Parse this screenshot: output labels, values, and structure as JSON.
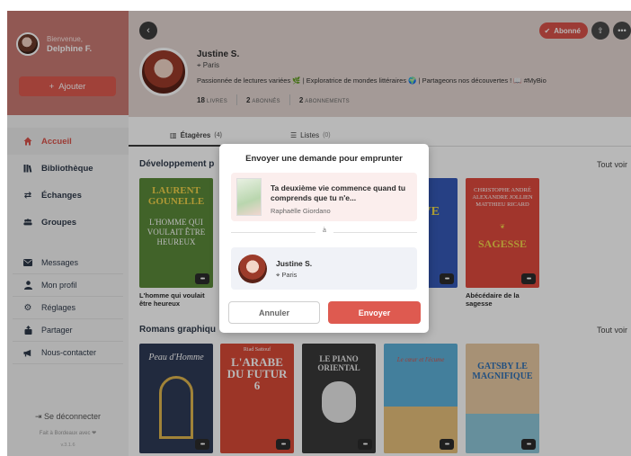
{
  "sidebar": {
    "greeting": "Bienvenue,",
    "user_name": "Delphine F.",
    "add_label": "Ajouter",
    "main_items": [
      {
        "label": "Accueil",
        "icon": "home-icon"
      },
      {
        "label": "Bibliothèque",
        "icon": "library-icon"
      },
      {
        "label": "Échanges",
        "icon": "exchange-icon"
      },
      {
        "label": "Groupes",
        "icon": "groups-icon"
      }
    ],
    "secondary_items": [
      {
        "label": "Messages",
        "icon": "mail-icon"
      },
      {
        "label": "Mon profil",
        "icon": "user-icon"
      },
      {
        "label": "Réglages",
        "icon": "gear-icon"
      },
      {
        "label": "Partager",
        "icon": "share-icon"
      },
      {
        "label": "Nous-contacter",
        "icon": "megaphone-icon"
      }
    ],
    "logout": "Se déconnecter",
    "made_in": "Fait à Bordeaux avec ❤",
    "version": "v.3.1.6"
  },
  "profile": {
    "subscribed_label": "Abonné",
    "name": "Justine S.",
    "city": "Paris",
    "bio": "Passionnée de lectures variées 🌿 | Exploratrice de mondes littéraires 🌍 | Partageons nos découvertes ! 📖 #MyBio",
    "stats": {
      "books_count": "18",
      "books_label": "LIVRES",
      "followers_count": "2",
      "followers_label": "ABONNÉS",
      "following_count": "2",
      "following_label": "ABONNEMENTS"
    }
  },
  "tabs": [
    {
      "label": "Étagères",
      "count": "(4)"
    },
    {
      "label": "Listes",
      "count": "(0)"
    }
  ],
  "sections": [
    {
      "title": "Développement p",
      "see_all": "Tout voir",
      "books": [
        {
          "title": "L'homme qui voulait être heureux",
          "cover_author": "LAURENT GOUNELLE",
          "cover_title": "L'HOMME QUI VOULAIT ÊTRE HEUREUX",
          "color": "#5a8a3a"
        },
        {
          "title": "",
          "cover_author": "",
          "cover_title": "",
          "color": "#d9534a"
        },
        {
          "title": "",
          "cover_author": "",
          "cover_title": "",
          "color": "#3b7dc9"
        },
        {
          "title": "",
          "cover_author": "",
          "cover_title": "LF-VE",
          "color": "#3559b8"
        },
        {
          "title": "Abécédaire de la sagesse",
          "cover_author": "CHRISTOPHE ANDRÉ ALEXANDRE JOLLIEN MATTHIEU RICARD",
          "cover_title": "SAGESSE",
          "color": "#e04a3d"
        }
      ]
    },
    {
      "title": "Romans graphiqu",
      "see_all": "Tout voir",
      "books": [
        {
          "cover_title": "Peau d'Homme",
          "color": "#2f3b57"
        },
        {
          "cover_title": "L'ARABE DU FUTUR 6",
          "cover_author": "Riad Sattouf",
          "color": "#d84a36"
        },
        {
          "cover_title": "LE PIANO ORIENTAL",
          "color": "#3a3a3a"
        },
        {
          "cover_title": "Le cœur et l'écume",
          "color": "#5db0d8"
        },
        {
          "cover_title": "GATSBY LE MAGNIFIQUE",
          "color": "#e8c9a3"
        }
      ]
    }
  ],
  "modal": {
    "title": "Envoyer une demande pour emprunter",
    "book_title": "Ta deuxième vie commence quand tu comprends que tu n'e...",
    "book_author": "Raphaëlle Giordano",
    "to_label": "à",
    "lender_name": "Justine S.",
    "lender_city": "Paris",
    "cancel_label": "Annuler",
    "send_label": "Envoyer"
  },
  "colors": {
    "accent": "#de5a50",
    "sidebar_top": "#e9948c",
    "profile_bg": "#e3d6d2"
  }
}
